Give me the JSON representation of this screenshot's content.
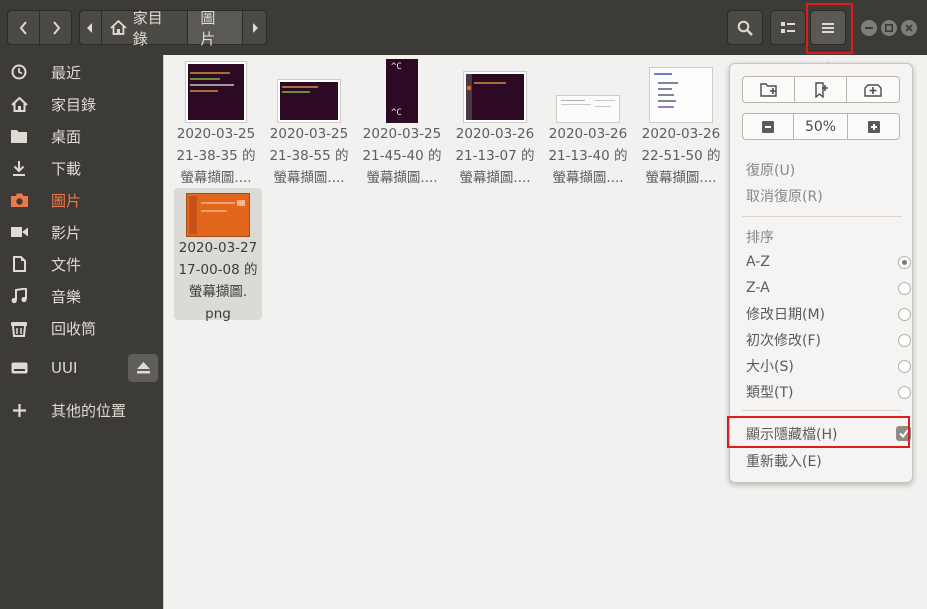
{
  "path": {
    "home_label": "家目錄",
    "current_label": "圖片"
  },
  "sidebar": {
    "items": [
      {
        "label": "最近",
        "icon": "clock-icon"
      },
      {
        "label": "家目錄",
        "icon": "home-icon"
      },
      {
        "label": "桌面",
        "icon": "folder-icon"
      },
      {
        "label": "下載",
        "icon": "download-icon"
      },
      {
        "label": "圖片",
        "icon": "camera-icon",
        "active": true
      },
      {
        "label": "影片",
        "icon": "video-icon"
      },
      {
        "label": "文件",
        "icon": "document-icon"
      },
      {
        "label": "音樂",
        "icon": "music-icon"
      },
      {
        "label": "回收筒",
        "icon": "trash-icon"
      },
      {
        "label": "UUI",
        "icon": "drive-icon"
      },
      {
        "label": "其他的位置",
        "icon": "plus-icon"
      }
    ]
  },
  "files": [
    {
      "line1": "2020-03-25",
      "line2": "21-38-35 的",
      "line3": "螢幕擷圖...."
    },
    {
      "line1": "2020-03-25",
      "line2": "21-38-55 的",
      "line3": "螢幕擷圖...."
    },
    {
      "line1": "2020-03-25",
      "line2": "21-45-40 的",
      "line3": "螢幕擷圖...."
    },
    {
      "line1": "2020-03-26",
      "line2": "21-13-07 的",
      "line3": "螢幕擷圖...."
    },
    {
      "line1": "2020-03-26",
      "line2": "21-13-40 的",
      "line3": "螢幕擷圖...."
    },
    {
      "line1": "2020-03-26",
      "line2": "22-51-50 的",
      "line3": "螢幕擷圖...."
    },
    {
      "line1": "2020-03-27",
      "line2": "17-00-08 的",
      "line3": "螢幕擷圖.",
      "line4": "png"
    }
  ],
  "thumb_text": {
    "c1": "^C",
    "c2": "^C"
  },
  "menu": {
    "zoom_value": "50%",
    "undo": "復原(U)",
    "redo": "取消復原(R)",
    "sort_header": "排序",
    "sort_az": "A-Z",
    "sort_za": "Z-A",
    "sort_modified": "修改日期(M)",
    "sort_first_modified": "初次修改(F)",
    "sort_size": "大小(S)",
    "sort_type": "類型(T)",
    "show_hidden": "顯示隱藏檔(H)",
    "reload": "重新載入(E)"
  },
  "colors": {
    "accent": "#f07746",
    "highlight": "#e01b1b",
    "header_bg": "#3c3b37"
  }
}
